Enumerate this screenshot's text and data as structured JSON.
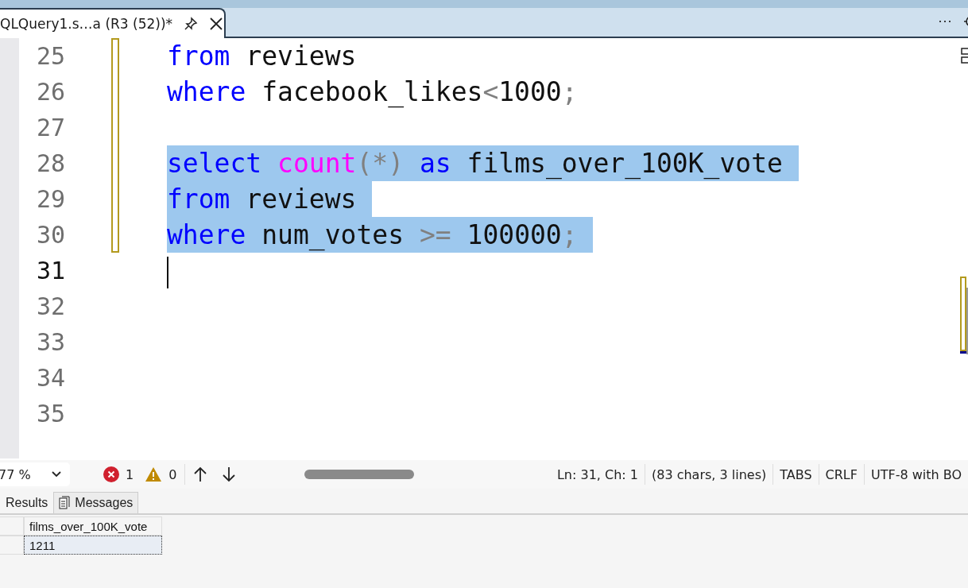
{
  "document_tab": {
    "title": "QLQuery1.s…a (R3 (52))*",
    "selected": true
  },
  "tab_strip": {
    "more": "···"
  },
  "editor": {
    "lines": [
      {
        "number": "25",
        "changed": true,
        "selected": false,
        "current": false,
        "tokens": [
          {
            "kind": "keyword",
            "text": "from"
          },
          {
            "kind": "plain",
            "space": true,
            "text": "reviews"
          }
        ]
      },
      {
        "number": "26",
        "changed": true,
        "selected": false,
        "current": false,
        "tokens": [
          {
            "kind": "keyword",
            "text": "where"
          },
          {
            "kind": "plain",
            "space": true,
            "text": "facebook_likes"
          },
          {
            "kind": "operator",
            "text": "<"
          },
          {
            "kind": "plain",
            "text": "1000"
          },
          {
            "kind": "operator",
            "text": ";"
          }
        ]
      },
      {
        "number": "27",
        "changed": true,
        "selected": false,
        "current": false
      },
      {
        "number": "28",
        "changed": true,
        "selected": true,
        "current": false,
        "tokens": [
          {
            "kind": "keyword",
            "text": "select"
          },
          {
            "kind": "function",
            "space": true,
            "text": "count"
          },
          {
            "kind": "operator",
            "text": "(*)"
          },
          {
            "kind": "keyword",
            "space": true,
            "text": "as"
          },
          {
            "kind": "plain",
            "space": true,
            "text": "films_over_100K_vote"
          }
        ]
      },
      {
        "number": "29",
        "changed": true,
        "selected": true,
        "current": false,
        "tokens": [
          {
            "kind": "keyword",
            "text": "from"
          },
          {
            "kind": "plain",
            "space": true,
            "text": "reviews"
          }
        ]
      },
      {
        "number": "30",
        "changed": true,
        "selected": true,
        "current": false,
        "tokens": [
          {
            "kind": "keyword",
            "text": "where"
          },
          {
            "kind": "plain",
            "space": true,
            "text": "num_votes"
          },
          {
            "kind": "operator",
            "space": true,
            "text": ">="
          },
          {
            "kind": "plain",
            "space": true,
            "text": "100000"
          },
          {
            "kind": "operator",
            "text": ";"
          }
        ]
      },
      {
        "number": "31",
        "changed": false,
        "selected": false,
        "current": true
      },
      {
        "number": "32",
        "changed": false,
        "selected": false,
        "current": false
      },
      {
        "number": "33",
        "changed": false,
        "selected": false,
        "current": false
      },
      {
        "number": "34",
        "changed": false,
        "selected": false,
        "current": false
      },
      {
        "number": "35",
        "changed": false,
        "selected": false,
        "current": false
      }
    ]
  },
  "status_bar": {
    "zoom": "77 %",
    "errors": "1",
    "warnings": "0",
    "items": [
      "Ln: 31, Ch: 1",
      "(83 chars, 3 lines)",
      "TABS",
      "CRLF",
      "UTF-8 with BO"
    ]
  },
  "result_tabs": [
    {
      "label": "Results",
      "selected": true,
      "kind": "grid"
    },
    {
      "label": "Messages",
      "selected": false,
      "kind": "messages"
    }
  ],
  "results": {
    "columns": [
      "films_over_100K_vote"
    ],
    "rows": [
      [
        "1211"
      ]
    ]
  }
}
